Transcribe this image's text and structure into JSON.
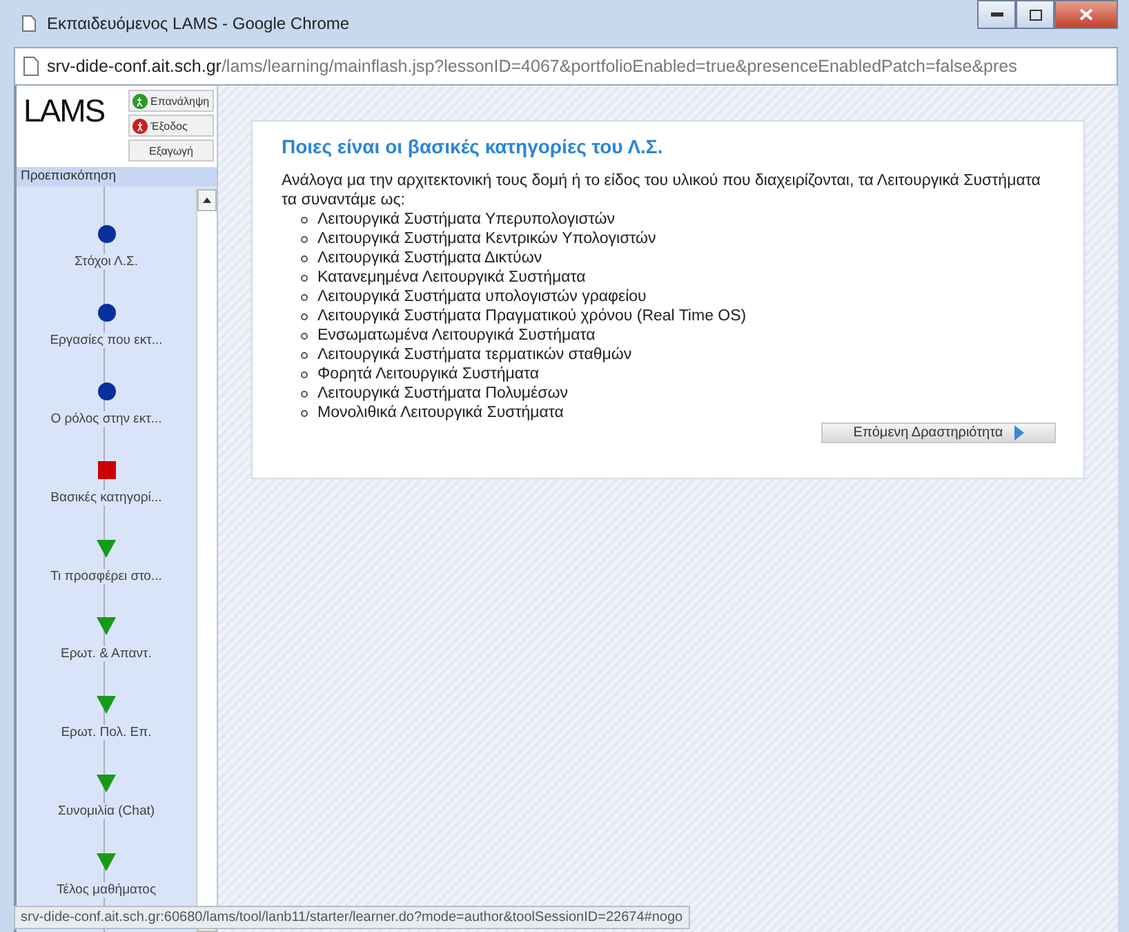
{
  "window": {
    "title": "Εκπαιδευόμενος LAMS - Google Chrome"
  },
  "address_bar": {
    "host": "srv-dide-conf.ait.sch.gr",
    "path": "/lams/learning/mainflash.jsp?lessonID=4067&portfolioEnabled=true&presenceEnabledPatch=false&pres"
  },
  "sidebar": {
    "logo": "LAMS",
    "buttons": [
      {
        "label": "Επανάληψη",
        "kind": "restart"
      },
      {
        "label": "Έξοδος",
        "kind": "exit"
      },
      {
        "label": "Εξαγωγή",
        "kind": "plain"
      }
    ],
    "header": "Προεπισκόπηση",
    "activities": [
      {
        "label": "Στόχοι Λ.Σ.",
        "kind": "completed"
      },
      {
        "label": "Εργασίες που εκτ...",
        "kind": "completed"
      },
      {
        "label": "Ο ρόλος στην εκτ...",
        "kind": "completed"
      },
      {
        "label": "Βασικές κατηγορί...",
        "kind": "current"
      },
      {
        "label": "Τι προσφέρει στο...",
        "kind": "pending"
      },
      {
        "label": "Ερωτ. & Απαντ.",
        "kind": "pending"
      },
      {
        "label": "Ερωτ. Πολ. Επ.",
        "kind": "pending"
      },
      {
        "label": "Συνομιλία (Chat)",
        "kind": "pending"
      },
      {
        "label": "Τέλος μαθήματος",
        "kind": "pending"
      }
    ]
  },
  "content": {
    "heading": "Ποιες είναι οι βασικές κατηγορίες του Λ.Σ.",
    "intro": "Ανάλογα μα την αρχιτεκτονική τους δομή ή το είδος του υλικού που διαχειρίζονται, τα Λειτουργικά Συστήματα τα συναντάμε ως:",
    "items": [
      "Λειτουργικά Συστήματα Υπερυπολογιστών",
      "Λειτουργικά Συστήματα Κεντρικών Υπολογιστών",
      "Λειτουργικά Συστήματα Δικτύων",
      "Κατανεμημένα Λειτουργικά Συστήματα",
      "Λειτουργικά Συστήματα υπολογιστών γραφείου",
      "Λειτουργικά Συστήματα Πραγματικού χρόνου (Real Time OS)",
      "Ενσωματωμένα Λειτουργικά Συστήματα",
      "Λειτουργικά Συστήματα τερματικών σταθμών",
      "Φορητά Λειτουργικά Συστήματα",
      "Λειτουργικά Συστήματα Πολυμέσων",
      "Μονολιθικά Λειτουργικά Συστήματα"
    ],
    "next_button": "Επόμενη Δραστηριότητα"
  },
  "status_bar": "srv-dide-conf.ait.sch.gr:60680/lams/tool/lanb11/starter/learner.do?mode=author&toolSessionID=22674#nogo"
}
